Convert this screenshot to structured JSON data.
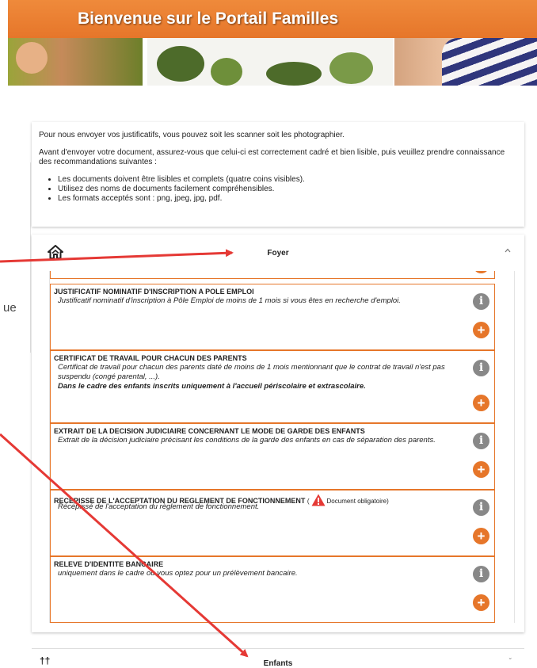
{
  "banner": {
    "title": "Bienvenue sur le Portail Familles"
  },
  "info": {
    "line1": "Pour nous envoyer vos justificatifs, vous pouvez soit les scanner soit les photographier.",
    "line2": "Avant d'envoyer votre document, assurez-vous que celui-ci est correctement cadré et bien lisible, puis veuillez prendre connaissance des recommandations suivantes :",
    "bullets": [
      "Les documents doivent être lisibles et complets (quatre coins visibles).",
      "Utilisez des noms de documents facilement compréhensibles.",
      "Les formats acceptés sont : png, jpeg, jpg, pdf."
    ]
  },
  "left": {
    "partial_text": "ue"
  },
  "foyer": {
    "title": "Foyer",
    "documents": [
      {
        "title": "JUSTIFICATIF NOMINATIF D'INSCRIPTION A POLE EMPLOI",
        "description": "Justificatif nominatif d'inscription à Pôle Emploi de moins de 1 mois si vous êtes en recherche d'emploi.",
        "note": ""
      },
      {
        "title": "CERTIFICAT DE TRAVAIL POUR CHACUN DES PARENTS",
        "description": "Certificat de travail pour chacun des parents daté de moins de 1 mois mentionnant que le contrat de travail n'est pas suspendu (congé parental, ...).",
        "note": "Dans le cadre des enfants inscrits uniquement à l'accueil périscolaire et extrascolaire."
      },
      {
        "title": "EXTRAIT DE LA DECISION JUDICIAIRE CONCERNANT LE MODE DE GARDE DES ENFANTS",
        "description": "Extrait de la décision judiciaire précisant les conditions de la garde des enfants en cas de séparation des parents.",
        "note": ""
      },
      {
        "title": "RECEPISSE DE L'ACCEPTATION DU REGLEMENT DE FONCTIONNEMENT",
        "title_suffix_open": "(",
        "mandatory_label": "Document obligatoire)",
        "description": "Récépissé de l'acceptation du règlement de fonctionnement.",
        "note": ""
      },
      {
        "title": "RELEVE D'IDENTITE BANCAIRE",
        "description": "uniquement dans le cadre ou vous optez pour un prélèvement bancaire.",
        "note": ""
      }
    ],
    "info_glyph": "i",
    "add_glyph": "+"
  },
  "enfants": {
    "title": "Enfants",
    "icon_glyph": "††",
    "chevron_glyph": "ˇ"
  },
  "colors": {
    "accent": "#e6762a",
    "info_button": "#888888",
    "arrow": "#e53935"
  },
  "icons": [
    "home-icon",
    "chevron-up-icon",
    "info-icon",
    "add-icon",
    "warning-icon",
    "children-icon",
    "chevron-down-icon"
  ]
}
